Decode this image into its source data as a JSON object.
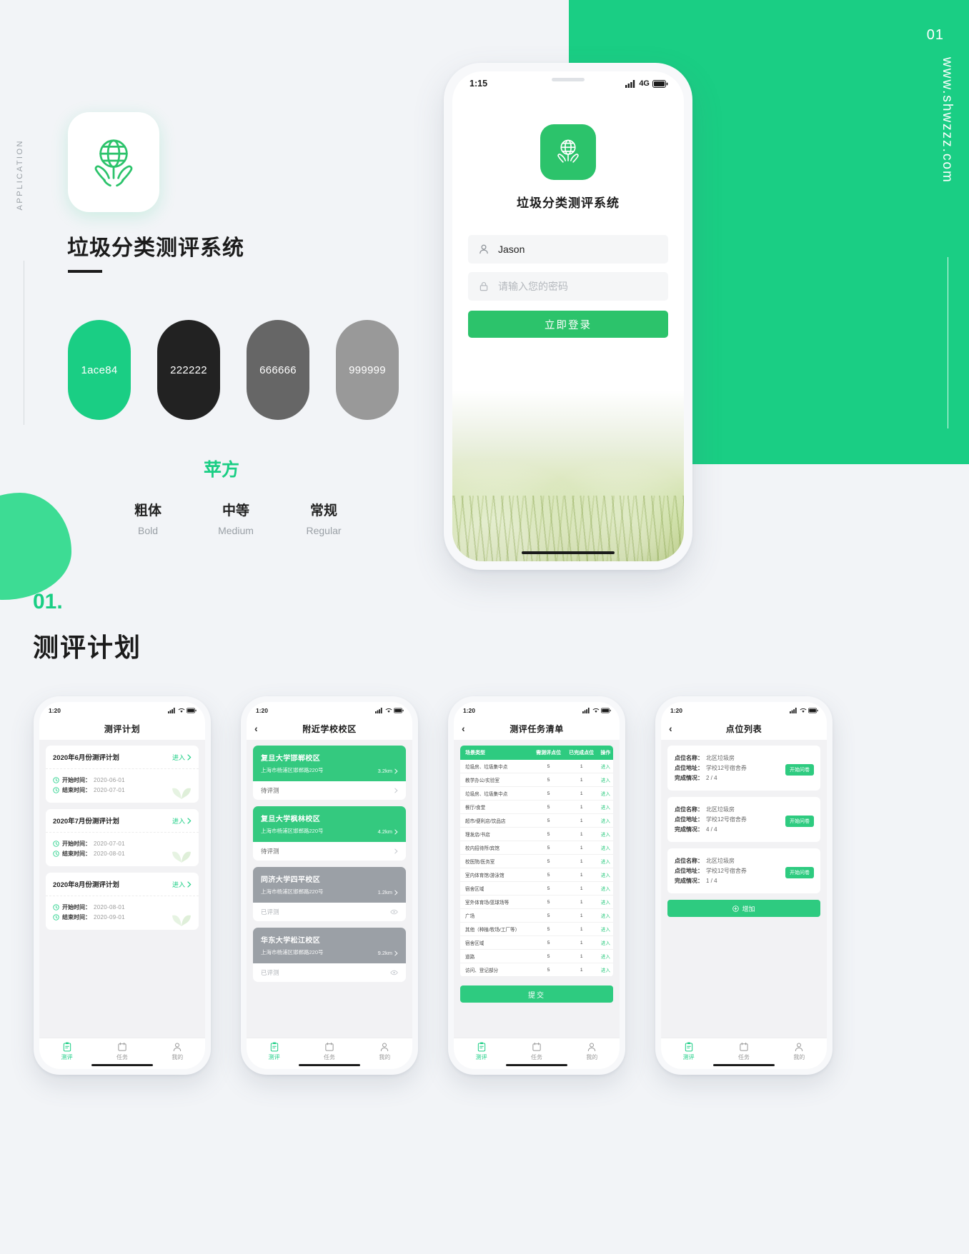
{
  "page": {
    "number": "01",
    "site_url": "www.shwzzz.com",
    "application_label": "APPLICATION"
  },
  "brand": {
    "app_title": "垃圾分类测评系统",
    "icon_name": "globe-in-hands-icon",
    "colors": [
      {
        "hex": "1ace84",
        "css": "#1ace84"
      },
      {
        "hex": "222222",
        "css": "#222222"
      },
      {
        "hex": "666666",
        "css": "#666666"
      },
      {
        "hex": "999999",
        "css": "#999999"
      }
    ],
    "typography": {
      "family": "苹方",
      "weights": [
        {
          "cn": "粗体",
          "en": "Bold"
        },
        {
          "cn": "中等",
          "en": "Medium"
        },
        {
          "cn": "常规",
          "en": "Regular"
        }
      ]
    }
  },
  "section": {
    "number": "01.",
    "title": "测评计划"
  },
  "login_phone": {
    "status": {
      "time": "1:15",
      "network": "4G"
    },
    "logo_title": "垃圾分类测评系统",
    "username_value": "Jason",
    "password_placeholder": "请输入您的密码",
    "login_button": "立即登录"
  },
  "tabbar": {
    "items": [
      {
        "label": "测评",
        "icon": "clipboard-icon",
        "active": true
      },
      {
        "label": "任务",
        "icon": "calendar-icon",
        "active": false
      },
      {
        "label": "我的",
        "icon": "user-icon",
        "active": false
      }
    ]
  },
  "phone1": {
    "status_time": "1:20",
    "title": "测评计划",
    "plans": [
      {
        "name": "2020年6月份测评计划",
        "enter": "进入",
        "start_label": "开始时间：",
        "start_value": "2020-06-01",
        "end_label": "结束时间：",
        "end_value": "2020-07-01"
      },
      {
        "name": "2020年7月份测评计划",
        "enter": "进入",
        "start_label": "开始时间：",
        "start_value": "2020-07-01",
        "end_label": "结束时间：",
        "end_value": "2020-08-01"
      },
      {
        "name": "2020年8月份测评计划",
        "enter": "进入",
        "start_label": "开始时间：",
        "start_value": "2020-08-01",
        "end_label": "结束时间：",
        "end_value": "2020-09-01"
      }
    ]
  },
  "phone2": {
    "status_time": "1:20",
    "title": "附近学校校区",
    "campuses": [
      {
        "name": "复旦大学邯郸校区",
        "address": "上海市杨浦区邯郸路220号",
        "distance": "3.2km",
        "status": "待评测",
        "state": "pending"
      },
      {
        "name": "复旦大学枫林校区",
        "address": "上海市杨浦区邯郸路220号",
        "distance": "4.2km",
        "status": "待评测",
        "state": "pending"
      },
      {
        "name": "同济大学四平校区",
        "address": "上海市杨浦区邯郸路220号",
        "distance": "1.2km",
        "status": "已评测",
        "state": "done"
      },
      {
        "name": "华东大学松江校区",
        "address": "上海市杨浦区邯郸路220号",
        "distance": "9.2km",
        "status": "已评测",
        "state": "done"
      }
    ]
  },
  "phone3": {
    "status_time": "1:20",
    "title": "测评任务清单",
    "table": {
      "headers": [
        "场景类型",
        "需测评点位",
        "已完成点位",
        "操作"
      ],
      "rows": [
        [
          "垃圾房、垃圾集中点",
          "5",
          "1",
          "进入"
        ],
        [
          "教学办公/实验室",
          "5",
          "1",
          "进入"
        ],
        [
          "垃圾房、垃圾集中点",
          "5",
          "1",
          "进入"
        ],
        [
          "餐厅/食堂",
          "5",
          "1",
          "进入"
        ],
        [
          "超市/便利店/饮品店",
          "5",
          "1",
          "进入"
        ],
        [
          "理发店/书店",
          "5",
          "1",
          "进入"
        ],
        [
          "校内招待所/宾馆",
          "5",
          "1",
          "进入"
        ],
        [
          "校医院/医务室",
          "5",
          "1",
          "进入"
        ],
        [
          "室内体育馆/游泳馆",
          "5",
          "1",
          "进入"
        ],
        [
          "宿舍区域",
          "5",
          "1",
          "进入"
        ],
        [
          "室外体育场/篮球场等",
          "5",
          "1",
          "进入"
        ],
        [
          "广场",
          "5",
          "1",
          "进入"
        ],
        [
          "其他（种植/牧场/工厂等）",
          "5",
          "1",
          "进入"
        ],
        [
          "宿舍区域",
          "5",
          "1",
          "进入"
        ],
        [
          "道路",
          "5",
          "1",
          "进入"
        ],
        [
          "访问、登记部分",
          "5",
          "1",
          "进入"
        ]
      ]
    },
    "submit_button": "提交"
  },
  "phone4": {
    "status_time": "1:20",
    "title": "点位列表",
    "points": [
      {
        "name_label": "点位名称：",
        "name_value": "北区垃圾房",
        "addr_label": "点位地址：",
        "addr_value": "学校12号宿舍券",
        "progress_label": "完成情况：",
        "progress_value": "2 / 4",
        "action": "开始问卷"
      },
      {
        "name_label": "点位名称：",
        "name_value": "北区垃圾房",
        "addr_label": "点位地址：",
        "addr_value": "学校12号宿舍券",
        "progress_label": "完成情况：",
        "progress_value": "4 / 4",
        "action": "开始问卷"
      },
      {
        "name_label": "点位名称：",
        "name_value": "北区垃圾房",
        "addr_label": "点位地址：",
        "addr_value": "学校12号宿舍券",
        "progress_label": "完成情况：",
        "progress_value": "1 / 4",
        "action": "开始问卷"
      }
    ],
    "add_button": "增加"
  }
}
